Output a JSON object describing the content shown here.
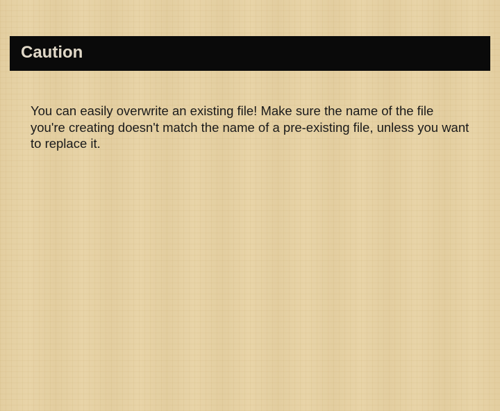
{
  "slide": {
    "title": "Caution",
    "body": "You can easily overwrite an existing file! Make sure the name of the file you're creating doesn't match the name of a pre-existing file, unless you want to replace it."
  }
}
